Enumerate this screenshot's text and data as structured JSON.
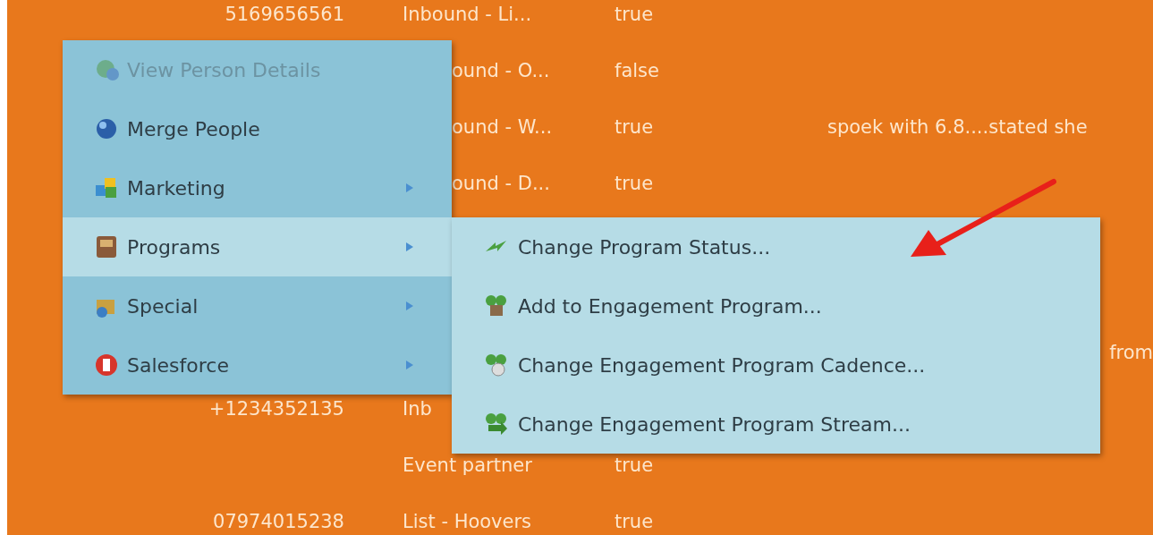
{
  "table": {
    "rows": [
      {
        "phone": "5169656561",
        "source": "Inbound - Li...",
        "source_covered": false,
        "value": "true",
        "note": ""
      },
      {
        "phone": "",
        "source": "ound - O...",
        "source_covered": true,
        "value": "false",
        "note": ""
      },
      {
        "phone": "",
        "source": "ound - W...",
        "source_covered": true,
        "value": "true",
        "note": "spoek with 6.8....stated she"
      },
      {
        "phone": "",
        "source": "ound - D...",
        "source_covered": true,
        "value": "true",
        "note": ""
      },
      {
        "phone": "",
        "source": "",
        "value": "",
        "note": ""
      },
      {
        "phone": "",
        "source": "",
        "value": "",
        "note": ""
      },
      {
        "phone": "",
        "source": "",
        "value": "",
        "note": "from",
        "note_at_edge": true
      },
      {
        "phone": "+1234352135",
        "source": "Inb",
        "source_covered": false,
        "value": "",
        "note": ""
      },
      {
        "phone": "",
        "source": "Event partner",
        "source_covered": false,
        "value": "true",
        "note": ""
      },
      {
        "phone": "07974015238",
        "source": "List - Hoovers",
        "source_covered": false,
        "value": "true",
        "note": ""
      }
    ]
  },
  "context_menu": {
    "items": [
      {
        "label": "View Person Details",
        "disabled": true,
        "selected": false,
        "has_submenu": false
      },
      {
        "label": "Merge People",
        "disabled": false,
        "selected": false,
        "has_submenu": false
      },
      {
        "label": "Marketing",
        "disabled": false,
        "selected": false,
        "has_submenu": true
      },
      {
        "label": "Programs",
        "disabled": false,
        "selected": true,
        "has_submenu": true
      },
      {
        "label": "Special",
        "disabled": false,
        "selected": false,
        "has_submenu": true
      },
      {
        "label": "Salesforce",
        "disabled": false,
        "selected": false,
        "has_submenu": true
      }
    ]
  },
  "submenu": {
    "items": [
      {
        "label": "Change Program Status..."
      },
      {
        "label": "Add to Engagement Program..."
      },
      {
        "label": "Change Engagement Program Cadence..."
      },
      {
        "label": "Change Engagement Program Stream..."
      }
    ]
  }
}
